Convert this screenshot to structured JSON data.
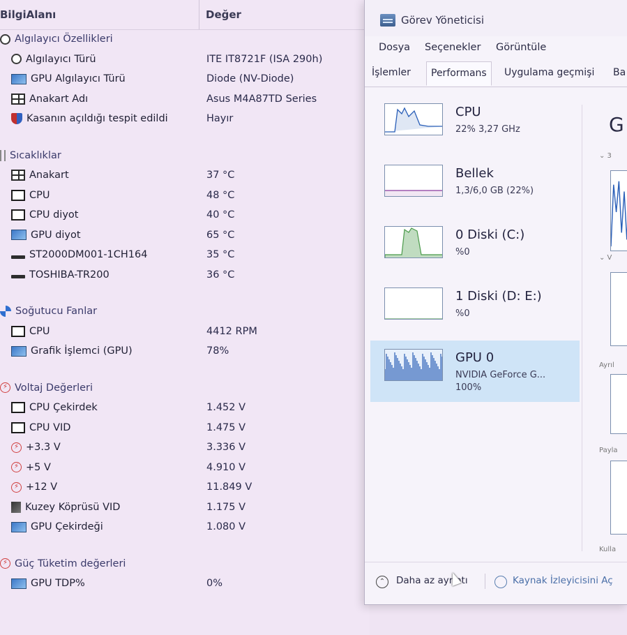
{
  "sensors": {
    "header": {
      "field": "BilgiAlanı",
      "value": "Değer"
    },
    "rows": [
      {
        "type": "group",
        "icon": "sensor-icon",
        "label": "Algılayıcı Özellikleri",
        "value": ""
      },
      {
        "type": "item",
        "icon": "sensor-icon",
        "label": "Algılayıcı Türü",
        "value": "ITE IT8721F  (ISA 290h)"
      },
      {
        "type": "item",
        "icon": "gpu-icon",
        "label": "GPU Algılayıcı Türü",
        "value": "Diode  (NV-Diode)"
      },
      {
        "type": "item",
        "icon": "motherboard-icon",
        "label": "Anakart Adı",
        "value": "Asus M4A87TD Series"
      },
      {
        "type": "item",
        "icon": "shield-icon",
        "label": "Kasanın açıldığı tespit edildi",
        "value": "Hayır"
      },
      {
        "type": "blank"
      },
      {
        "type": "group",
        "icon": "thermometer-icon",
        "label": "Sıcaklıklar",
        "value": ""
      },
      {
        "type": "item",
        "icon": "motherboard-icon",
        "label": "Anakart",
        "value": "37 °C"
      },
      {
        "type": "item",
        "icon": "cpu-icon",
        "label": "CPU",
        "value": "48 °C"
      },
      {
        "type": "item",
        "icon": "cpu-icon",
        "label": "CPU diyot",
        "value": "40 °C"
      },
      {
        "type": "item",
        "icon": "gpu-icon",
        "label": "GPU diyot",
        "value": "65 °C"
      },
      {
        "type": "item",
        "icon": "disk-icon",
        "label": "ST2000DM001-1CH164",
        "value": "35 °C"
      },
      {
        "type": "item",
        "icon": "disk-icon",
        "label": "TOSHIBA-TR200",
        "value": "36 °C"
      },
      {
        "type": "blank"
      },
      {
        "type": "group",
        "icon": "fan-icon",
        "label": "Soğutucu Fanlar",
        "value": ""
      },
      {
        "type": "item",
        "icon": "cpu-icon",
        "label": "CPU",
        "value": "4412 RPM"
      },
      {
        "type": "item",
        "icon": "gpu-icon",
        "label": "Grafik İşlemci (GPU)",
        "value": "78%"
      },
      {
        "type": "blank"
      },
      {
        "type": "group",
        "icon": "voltage-icon",
        "label": "Voltaj Değerleri",
        "value": ""
      },
      {
        "type": "item",
        "icon": "cpu-icon",
        "label": "CPU Çekirdek",
        "value": "1.452 V"
      },
      {
        "type": "item",
        "icon": "cpu-icon",
        "label": "CPU VID",
        "value": "1.475 V"
      },
      {
        "type": "item",
        "icon": "voltage-icon",
        "label": "+3.3 V",
        "value": "3.336 V"
      },
      {
        "type": "item",
        "icon": "voltage-icon",
        "label": "+5 V",
        "value": "4.910 V"
      },
      {
        "type": "item",
        "icon": "voltage-icon",
        "label": "+12 V",
        "value": "11.849 V"
      },
      {
        "type": "item",
        "icon": "northbridge-icon",
        "label": "Kuzey Köprüsü VID",
        "value": "1.175 V"
      },
      {
        "type": "item",
        "icon": "gpu-icon",
        "label": "GPU Çekirdeği",
        "value": "1.080 V"
      },
      {
        "type": "blank"
      },
      {
        "type": "group",
        "icon": "voltage-icon",
        "label": "Güç Tüketim değerleri",
        "value": ""
      },
      {
        "type": "item",
        "icon": "gpu-icon",
        "label": "GPU TDP%",
        "value": "0%"
      }
    ]
  },
  "taskmgr": {
    "title": "Görev Yöneticisi",
    "menu": [
      "Dosya",
      "Seçenekler",
      "Görüntüle"
    ],
    "tabs": [
      "İşlemler",
      "Performans",
      "Uygulama geçmişi",
      "Ba"
    ],
    "active_tab": "Performans",
    "perf": [
      {
        "name": "CPU",
        "sub": "22% 3,27 GHz",
        "sub2": "",
        "selected": false
      },
      {
        "name": "Bellek",
        "sub": "1,3/6,0 GB (22%)",
        "sub2": "",
        "selected": false
      },
      {
        "name": "0 Diski (C:)",
        "sub": "%0",
        "sub2": "",
        "selected": false
      },
      {
        "name": "1 Diski (D: E:)",
        "sub": "%0",
        "sub2": "",
        "selected": false
      },
      {
        "name": "GPU 0",
        "sub": "NVIDIA GeForce G...",
        "sub2": "100%",
        "selected": true
      }
    ],
    "detail": {
      "title": "G",
      "labels": {
        "l1": "⌄ 3",
        "l2": "⌄ V",
        "l3": "Ayrıl",
        "l4": "Payla",
        "l5": "Kulla"
      }
    },
    "footer": {
      "fewer": "Daha az ayrıntı",
      "resource_monitor": "Kaynak İzleyicisini Aç"
    }
  },
  "colors": {
    "accent_selected": "#cfe4f7",
    "graph_blue": "#2a5fb8",
    "graph_green": "#4a9a4a"
  }
}
